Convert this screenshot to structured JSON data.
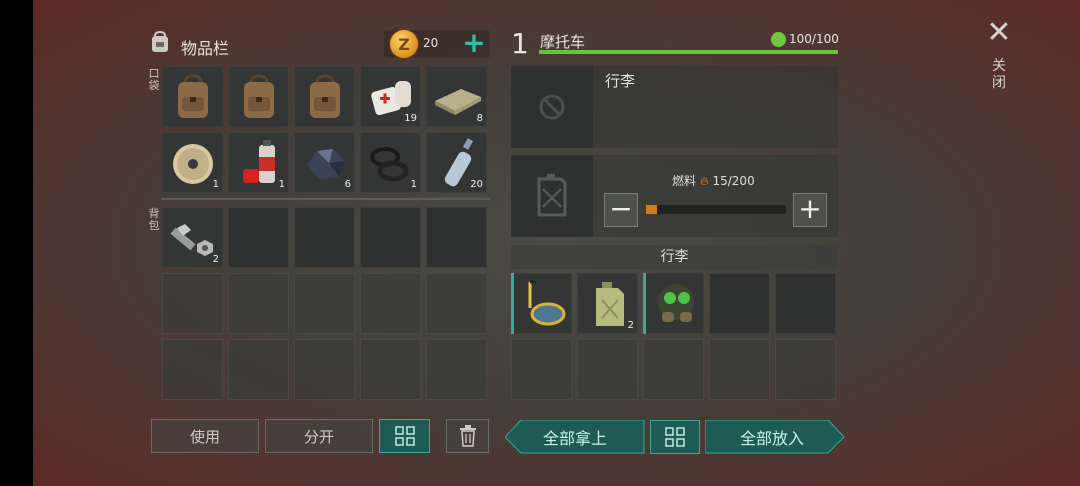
{
  "inventory": {
    "title": "物品栏",
    "coins": "20",
    "pocket_label": "口袋",
    "backpack_label": "背包",
    "pocket": [
      {
        "icon": "backpack-icon",
        "count": ""
      },
      {
        "icon": "backpack-icon",
        "count": ""
      },
      {
        "icon": "backpack-icon",
        "count": ""
      },
      {
        "icon": "bandage-icon",
        "count": "19"
      },
      {
        "icon": "cloth-icon",
        "count": "8"
      },
      {
        "icon": "wire-spool-icon",
        "count": "1"
      },
      {
        "icon": "spray-can-icon",
        "count": "1"
      },
      {
        "icon": "ore-icon",
        "count": "6"
      },
      {
        "icon": "rubber-rings-icon",
        "count": "1"
      },
      {
        "icon": "water-bottle-icon",
        "count": "20"
      }
    ],
    "backpack": [
      {
        "icon": "bolt-nut-icon",
        "count": "2"
      }
    ]
  },
  "buttons": {
    "use": "使用",
    "split": "分开",
    "take_all": "全部拿上",
    "put_all": "全部放入"
  },
  "vehicle": {
    "number": "1",
    "name": "摩托车",
    "hp": "100/100",
    "hp_fraction": 1.0,
    "cargo_label": "行李",
    "fuel_label": "燃料",
    "fuel_value": "15/200",
    "fuel_fraction": 0.075,
    "luggage_header": "行李",
    "luggage": [
      {
        "icon": "snorkel-mask-icon",
        "count": ""
      },
      {
        "icon": "jerrycan-icon",
        "count": "2"
      },
      {
        "icon": "gas-mask-icon",
        "count": ""
      }
    ]
  },
  "close": {
    "label": "关闭"
  },
  "colors": {
    "accent": "#2fc1a5",
    "hp_green": "#62c53a",
    "fuel_orange": "#d07a1a"
  }
}
